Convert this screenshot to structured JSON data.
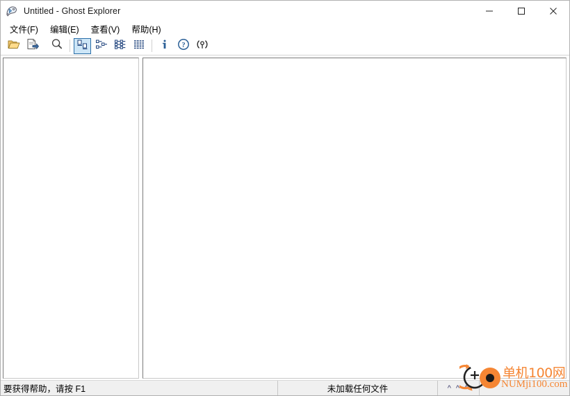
{
  "window": {
    "title": "Untitled - Ghost Explorer",
    "icon": "ghost-app-icon",
    "controls": {
      "minimize": "minimize-icon",
      "maximize": "maximize-icon",
      "close": "close-icon"
    }
  },
  "menubar": {
    "items": [
      {
        "label": "文件(F)",
        "name": "menu-file"
      },
      {
        "label": "编辑(E)",
        "name": "menu-edit"
      },
      {
        "label": "查看(V)",
        "name": "menu-view"
      },
      {
        "label": "帮助(H)",
        "name": "menu-help"
      }
    ]
  },
  "toolbar": {
    "buttons": [
      {
        "name": "open-folder-button",
        "icon": "open-folder-icon",
        "checked": false
      },
      {
        "name": "extract-button",
        "icon": "extract-file-icon",
        "checked": false
      },
      {
        "name": "find-button",
        "icon": "magnifier-icon",
        "checked": false
      },
      {
        "name": "view-large-icons-button",
        "icon": "large-icons-icon",
        "checked": true
      },
      {
        "name": "view-small-icons-button",
        "icon": "small-icons-icon",
        "checked": false
      },
      {
        "name": "view-list-button",
        "icon": "list-view-icon",
        "checked": false
      },
      {
        "name": "view-details-button",
        "icon": "details-view-icon",
        "checked": false
      },
      {
        "name": "image-info-button",
        "icon": "info-icon",
        "checked": false
      },
      {
        "name": "help-button",
        "icon": "question-mark-icon",
        "checked": false
      },
      {
        "name": "about-button",
        "icon": "about-icon",
        "checked": false
      }
    ]
  },
  "panes": {
    "tree": {
      "name": "folder-tree-pane",
      "content": ""
    },
    "list": {
      "name": "file-list-pane",
      "content": ""
    }
  },
  "statusbar": {
    "help_text": "要获得帮助，请按 F1",
    "file_status": "未加载任何文件",
    "caret_indicator": "^ ^ ^",
    "end_cell": ""
  },
  "watermark": {
    "text_cn": "单机100网",
    "text_en": "NUMji100.com",
    "color": "#f58634"
  }
}
